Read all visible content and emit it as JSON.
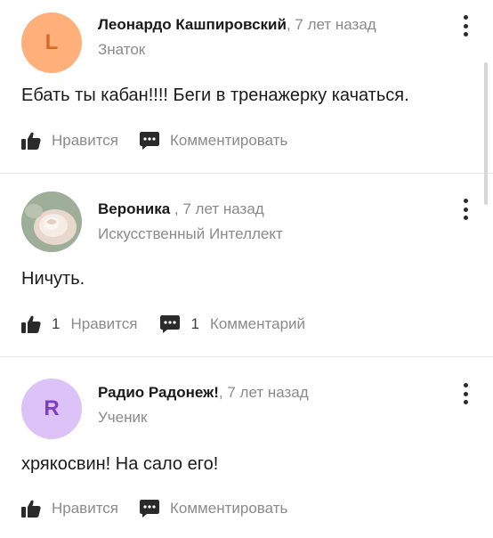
{
  "comments": [
    {
      "author": "Леонардо Кашпировский",
      "separator": ",",
      "time": "7 лет назад",
      "rank": "Знаток",
      "avatar_letter": "L",
      "text": "Ебать ты кабан!!!! Беги в тренажерку качаться.",
      "like_count": "",
      "like_label": "Нравится",
      "comment_count": "",
      "comment_label": "Комментировать"
    },
    {
      "author": "Вероника",
      "separator": " ,",
      "time": "7 лет назад",
      "rank": "Искусственный Интеллект",
      "avatar_letter": "",
      "text": "Ничуть.",
      "like_count": "1",
      "like_label": "Нравится",
      "comment_count": "1",
      "comment_label": "Комментарий"
    },
    {
      "author": "Радио Радонеж!",
      "separator": ",",
      "time": "7 лет назад",
      "rank": "Ученик",
      "avatar_letter": "R",
      "text": "хрякосвин! На сало его!",
      "like_count": "",
      "like_label": "Нравится",
      "comment_count": "",
      "comment_label": "Комментировать"
    }
  ],
  "icons": {
    "like": "thumbs-up-icon",
    "comment": "comment-bubble-icon",
    "menu": "more-vertical-icon"
  },
  "colors": {
    "avatar_l_bg": "#ffb07a",
    "avatar_r_bg": "#dcc2f6",
    "muted_text": "#8a8a8a"
  }
}
